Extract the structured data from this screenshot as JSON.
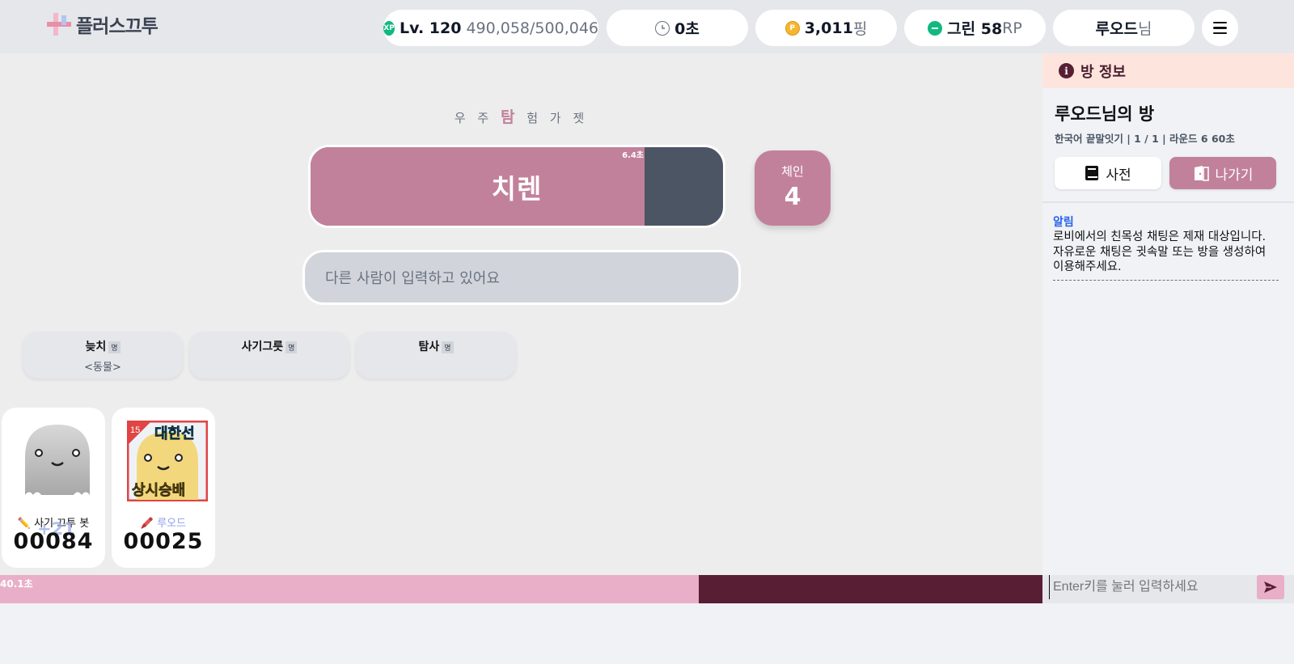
{
  "app": {
    "logo_text": "플러스끄투"
  },
  "header": {
    "level_label": "Lv. 120",
    "xp_progress": "490,058/500,046",
    "time_value": "0초",
    "ping_value": "3,011",
    "ping_unit": "핑",
    "rp_rank": "그린 58",
    "rp_unit": "RP",
    "user_name": "루오드",
    "user_suffix": "님"
  },
  "game": {
    "hint_before": "우 주",
    "hint_highlight": "탐",
    "hint_after": "험 가 젯",
    "current_word": "치렌",
    "word_timer": "6.4초",
    "word_progress": 0.81,
    "chain_label": "체인",
    "chain_value": "4",
    "input_placeholder": "다른 사람이 입력하고 있어요",
    "missions": [
      {
        "title": "늦치",
        "tag": "명",
        "sub": "<동물>"
      },
      {
        "title": "사기그릇",
        "tag": "명",
        "sub": ""
      },
      {
        "title": "탐사",
        "tag": "명",
        "sub": ""
      }
    ],
    "players": [
      {
        "name": "사기 끄투 봇",
        "score": "00084",
        "gain": "+21"
      },
      {
        "name": "루오드",
        "score": "00025",
        "badge_top": "대한선",
        "badge_bottom": "상시승배",
        "badge_level": "15"
      }
    ],
    "round_timer": "40.1초",
    "round_progress": 0.67
  },
  "side": {
    "header": "방 정보",
    "room_title": "루오드님의 방",
    "room_meta": "한국어 끝말잇기 | 1 / 1 | 라운드 6 60초",
    "dict_button": "사전",
    "exit_button": "나가기",
    "notice_label": "알림",
    "notice_text": "로비에서의 친목성 채팅은 제재 대상입니다. 자유로운 채팅은 귓속말 또는 방을 생성하여 이용해주세요."
  },
  "chat": {
    "placeholder": "Enter키를 눌러 입력하세요"
  },
  "colors": {
    "accent": "#c2819a",
    "dark": "#581f34",
    "bar": "#e9afc9"
  }
}
